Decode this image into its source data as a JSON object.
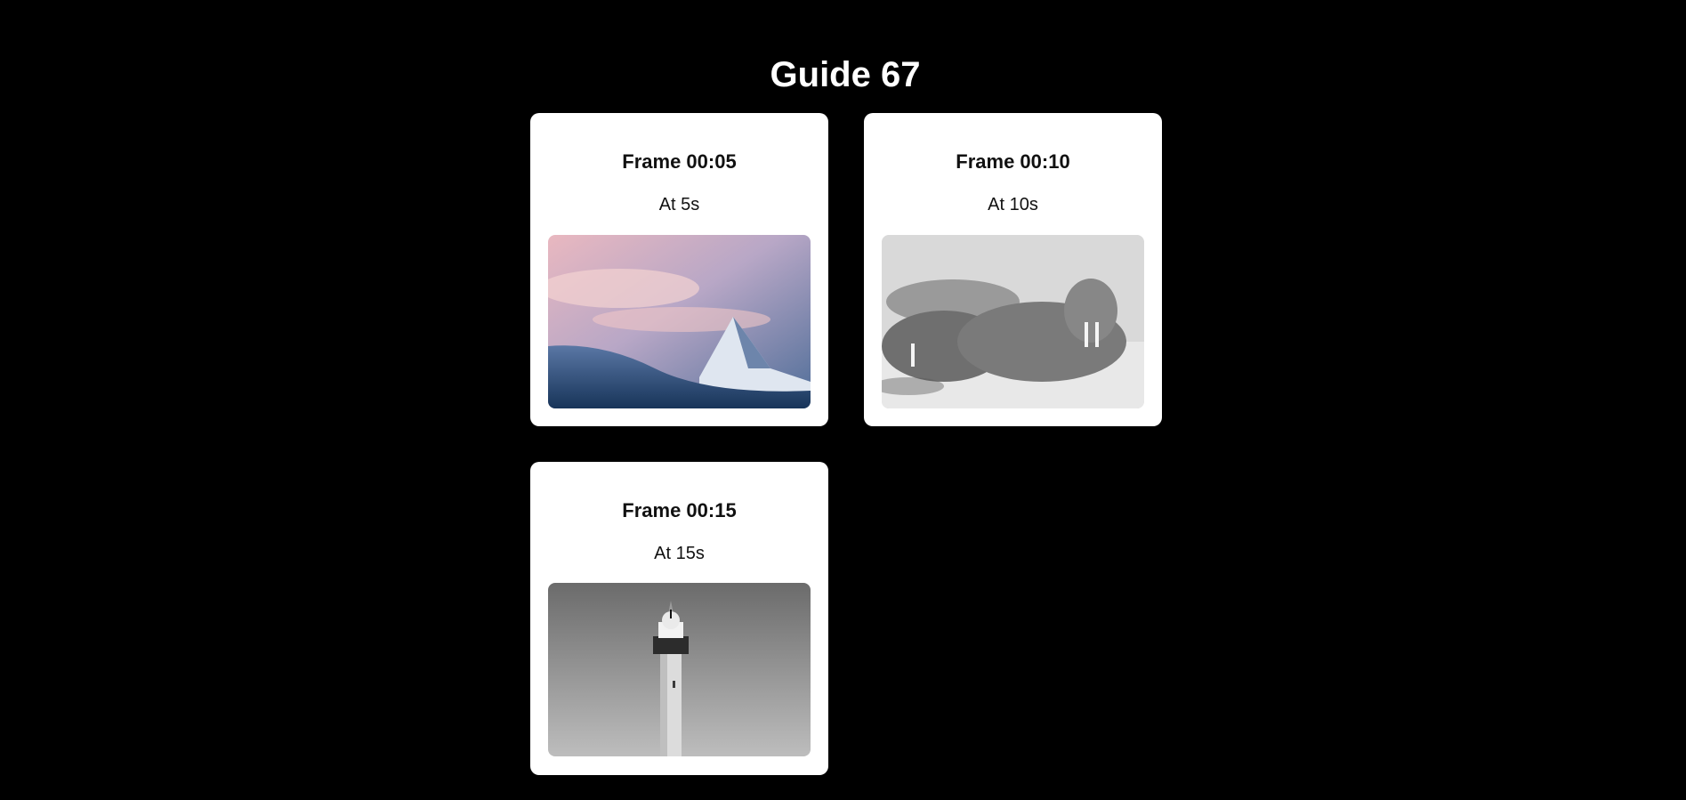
{
  "page": {
    "title": "Guide 67"
  },
  "frames": [
    {
      "title": "Frame 00:05",
      "caption": "At 5s",
      "image": "mountain-peak-at-sunset"
    },
    {
      "title": "Frame 00:10",
      "caption": "At 10s",
      "image": "walruses-on-beach"
    },
    {
      "title": "Frame 00:15",
      "caption": "At 15s",
      "image": "lighthouse-at-night"
    }
  ]
}
